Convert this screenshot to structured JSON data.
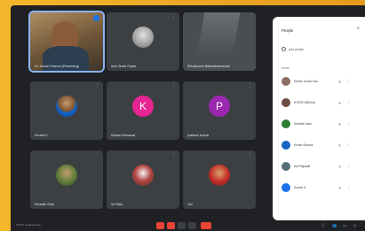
{
  "panel": {
    "title": "People",
    "close_icon": "close-icon",
    "add_label": "Add people",
    "section_label": "In call",
    "participants": [
      {
        "name": "Dinesh Kumar Das",
        "color": "#8d6e63"
      },
      {
        "name": "HITESH MEENA",
        "color": "#6d4c41"
      },
      {
        "name": "Shrinath Saini",
        "color": "#2e7d32"
      },
      {
        "name": "Kumar Sharma",
        "color": "#1565c0"
      },
      {
        "name": "Adi Prajapati",
        "color": "#546e7a"
      },
      {
        "name": "Suresh K",
        "color": "#1a73e8"
      }
    ]
  },
  "tiles": [
    {
      "name": "Dr. Kumar Sharma (Presenting)",
      "type": "photo"
    },
    {
      "name": "Isha Jindal Gupta",
      "type": "photo"
    },
    {
      "name": "Shivakumar Balasubramanian",
      "type": "photo"
    },
    {
      "name": "Suresh K",
      "type": "photo"
    },
    {
      "name": "Kishan Kumawat",
      "type": "letter",
      "letter": "K",
      "color": "#e52592"
    },
    {
      "name": "prakash Kumar",
      "type": "letter",
      "letter": "P",
      "color": "#9c27b0"
    },
    {
      "name": "Shrinath Saini",
      "type": "photo"
    },
    {
      "name": "Sri Ram",
      "type": "photo"
    },
    {
      "name": "You",
      "type": "photo"
    }
  ],
  "bottom": {
    "meeting_info": "10:03 | xsl-ahnd-msy"
  },
  "colors": {
    "background": "#202124",
    "tile": "#3c4043",
    "accent": "#1a73e8",
    "end_call": "#ea4335"
  }
}
